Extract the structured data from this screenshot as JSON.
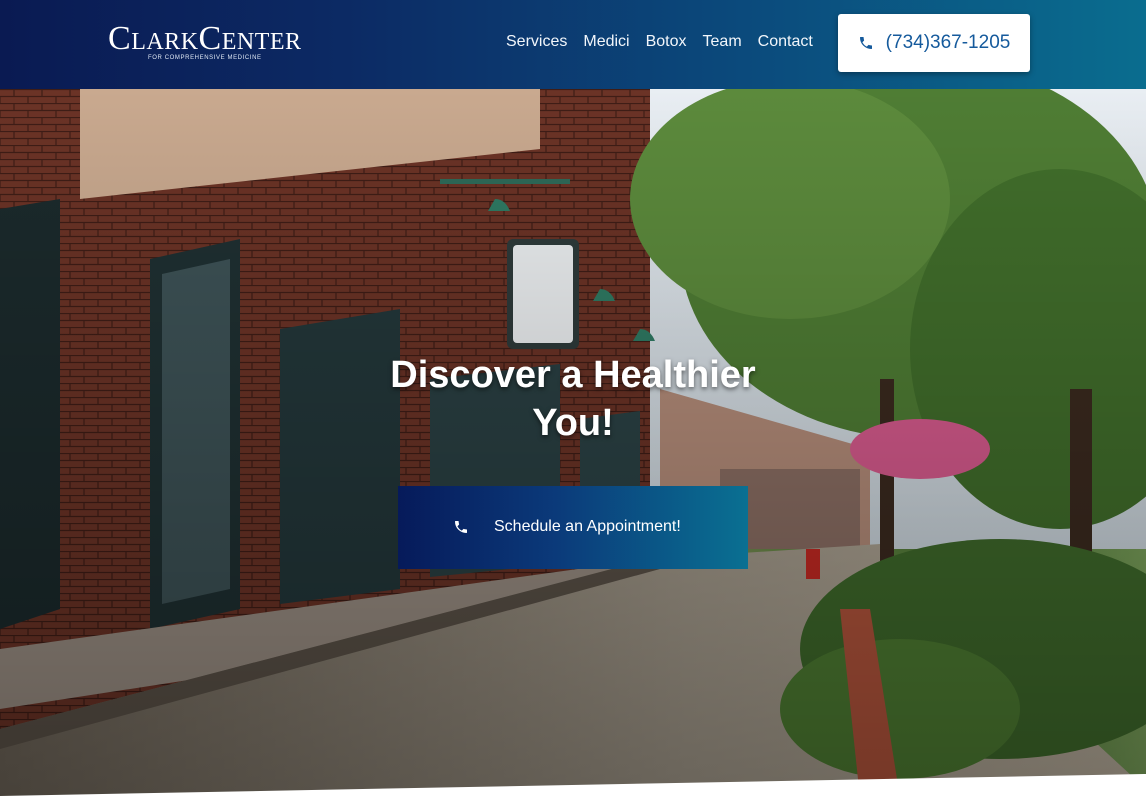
{
  "header": {
    "logo": {
      "main_a": "C",
      "main_b": "LARK",
      "main_c": "C",
      "main_d": "ENTER",
      "tagline": "FOR COMPREHENSIVE MEDICINE"
    },
    "nav": [
      {
        "label": "Services"
      },
      {
        "label": "Medici"
      },
      {
        "label": "Botox"
      },
      {
        "label": "Team"
      },
      {
        "label": "Contact"
      }
    ],
    "phone_button": {
      "label": "(734)367-1205",
      "icon": "phone-icon"
    }
  },
  "hero": {
    "title_line1": "Discover a Healthier",
    "title_line2": "You!",
    "cta": {
      "label": "Schedule an Appointment!",
      "icon": "phone-icon"
    }
  },
  "colors": {
    "header_gradient_start": "#0a1a52",
    "header_gradient_end": "#0a6d8f",
    "phone_text": "#155a9c",
    "cta_gradient_start": "#061a5a",
    "cta_gradient_end": "#0a7092"
  }
}
